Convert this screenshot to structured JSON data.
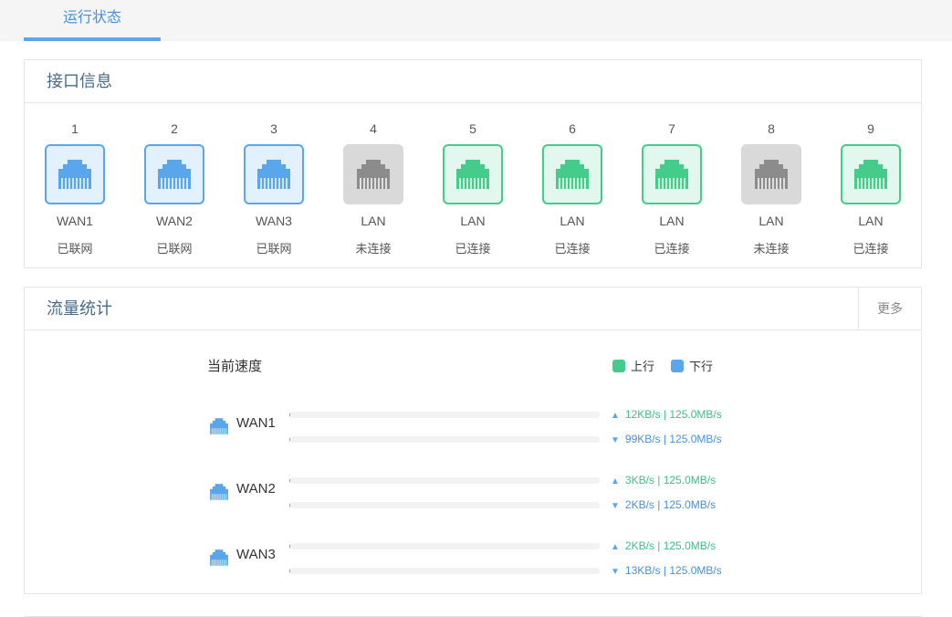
{
  "tab": {
    "label": "运行状态"
  },
  "interfaces": {
    "title": "接口信息",
    "ports": [
      {
        "num": "1",
        "type": "WAN1",
        "status": "已联网",
        "state": "wan"
      },
      {
        "num": "2",
        "type": "WAN2",
        "status": "已联网",
        "state": "wan"
      },
      {
        "num": "3",
        "type": "WAN3",
        "status": "已联网",
        "state": "wan"
      },
      {
        "num": "4",
        "type": "LAN",
        "status": "未连接",
        "state": "off"
      },
      {
        "num": "5",
        "type": "LAN",
        "status": "已连接",
        "state": "lan"
      },
      {
        "num": "6",
        "type": "LAN",
        "status": "已连接",
        "state": "lan"
      },
      {
        "num": "7",
        "type": "LAN",
        "status": "已连接",
        "state": "lan"
      },
      {
        "num": "8",
        "type": "LAN",
        "status": "未连接",
        "state": "off"
      },
      {
        "num": "9",
        "type": "LAN",
        "status": "已连接",
        "state": "lan"
      }
    ]
  },
  "traffic": {
    "title": "流量统计",
    "more_label": "更多",
    "speed_title": "当前速度",
    "legend_up": "上行",
    "legend_down": "下行",
    "wans": [
      {
        "name": "WAN1",
        "up": "12KB/s | 125.0MB/s",
        "down": "99KB/s | 125.0MB/s",
        "up_fraction": 0.0001,
        "down_fraction": 0.0008
      },
      {
        "name": "WAN2",
        "up": "3KB/s | 125.0MB/s",
        "down": "2KB/s | 125.0MB/s",
        "up_fraction": 2e-05,
        "down_fraction": 2e-05
      },
      {
        "name": "WAN3",
        "up": "2KB/s | 125.0MB/s",
        "down": "13KB/s | 125.0MB/s",
        "up_fraction": 2e-05,
        "down_fraction": 0.0001
      }
    ]
  },
  "icons": {
    "port": "ethernet-port-icon",
    "up": "triangle-up-icon",
    "down": "triangle-down-icon"
  },
  "colors": {
    "accent": "#5aa6ec",
    "wan_fill": "#5aa6ec",
    "lan_fill": "#45cc8a",
    "off_fill": "#8c8c8c",
    "up_text": "#3fc08a",
    "down_text": "#4a8fdc",
    "legend_up": "#45cc8a",
    "legend_down": "#5aa6ec"
  }
}
